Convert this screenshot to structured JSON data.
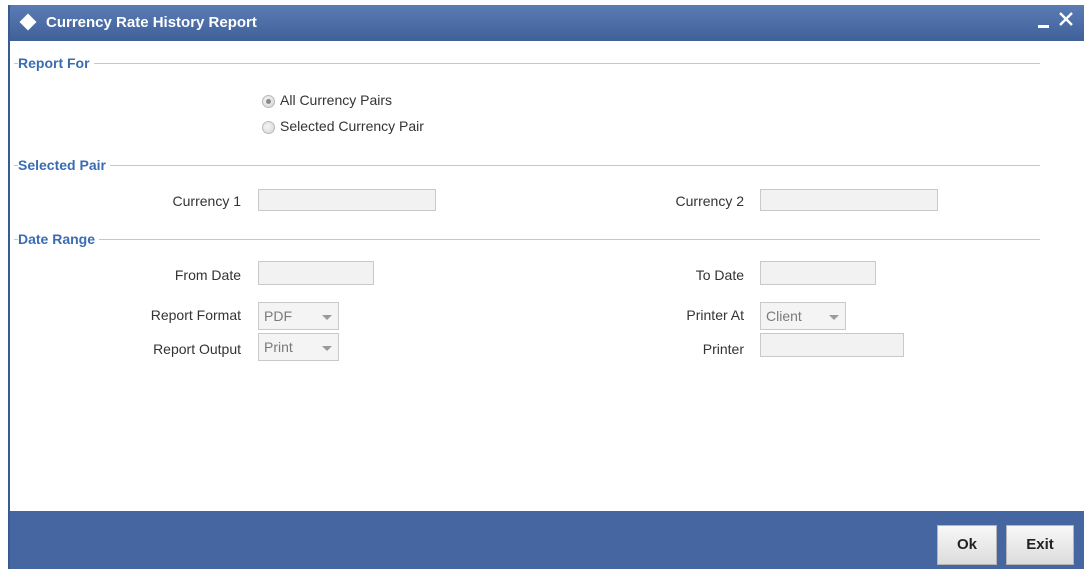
{
  "window": {
    "title": "Currency Rate History Report",
    "icons": {
      "title": "diamond-icon",
      "minimize": "minimize-icon",
      "close": "close-icon"
    }
  },
  "sections": {
    "report_for": "Report For",
    "selected_pair": "Selected Pair",
    "date_range": "Date Range"
  },
  "report_for": {
    "options": [
      {
        "label": "All Currency Pairs",
        "checked": true
      },
      {
        "label": "Selected Currency Pair",
        "checked": false
      }
    ]
  },
  "selected_pair": {
    "currency1_label": "Currency 1",
    "currency1_value": "",
    "currency2_label": "Currency 2",
    "currency2_value": ""
  },
  "date_range": {
    "from_date_label": "From Date",
    "from_date_value": "",
    "to_date_label": "To Date",
    "to_date_value": "",
    "report_format_label": "Report Format",
    "report_format_value": "PDF",
    "report_output_label": "Report Output",
    "report_output_value": "Print",
    "printer_at_label": "Printer At",
    "printer_at_value": "Client",
    "printer_label": "Printer",
    "printer_value": ""
  },
  "footer": {
    "ok_label": "Ok",
    "exit_label": "Exit"
  },
  "colors": {
    "titlebar": "#4a6ba6",
    "section_heading": "#3a6cb4",
    "footer": "#4566a0"
  }
}
